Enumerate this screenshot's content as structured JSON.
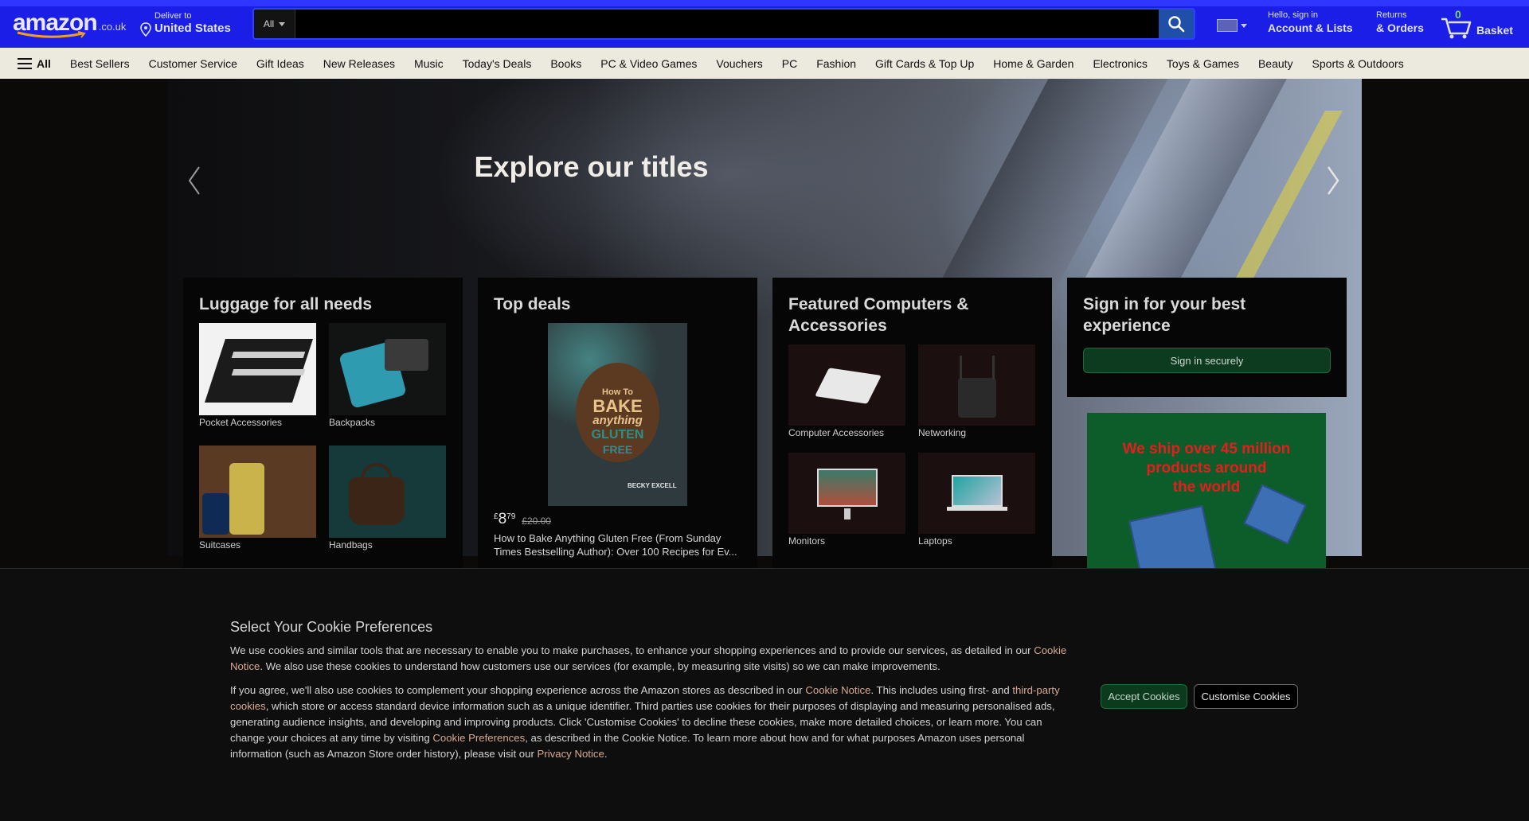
{
  "header": {
    "logo_text": "amazon",
    "logo_tld": ".co.uk",
    "deliver_line1": "Deliver to",
    "deliver_line2": "United States",
    "search": {
      "category": "All",
      "placeholder": "",
      "value": ""
    },
    "account_line1": "Hello, sign in",
    "account_line2": "Account & Lists",
    "orders_line1": "Returns",
    "orders_line2": "& Orders",
    "basket_count": "0",
    "basket_label": "Basket",
    "accent": "#1a1ee6"
  },
  "nav": {
    "all_label": "All",
    "items": [
      "Best Sellers",
      "Customer Service",
      "Gift Ideas",
      "New Releases",
      "Music",
      "Today's Deals",
      "Books",
      "PC & Video Games",
      "Vouchers",
      "PC",
      "Fashion",
      "Gift Cards & Top Up",
      "Home & Garden",
      "Electronics",
      "Toys & Games",
      "Beauty",
      "Sports & Outdoors"
    ]
  },
  "hero": {
    "title": "Explore our titles"
  },
  "cards": {
    "luggage": {
      "title": "Luggage for all needs",
      "tiles": [
        "Pocket Accessories",
        "Backpacks",
        "Suitcases",
        "Handbags"
      ]
    },
    "deals": {
      "title": "Top deals",
      "book_cover": {
        "line1": "How To",
        "line2": "BAKE",
        "line3": "anything",
        "line4": "GLUTEN",
        "line5": "FREE",
        "author": "BECKY EXCELL"
      },
      "price_symbol": "£",
      "price_whole": "8",
      "price_fraction": "79",
      "price_old": "£20.00",
      "description": "How to Bake Anything Gluten Free (From Sunday Times Bestselling Author): Over 100 Recipes for Ev..."
    },
    "computers": {
      "title": "Featured Computers & Accessories",
      "tiles": [
        "Computer Accessories",
        "Networking",
        "Monitors",
        "Laptops"
      ]
    },
    "signin": {
      "title": "Sign in for your best experience",
      "button": "Sign in securely"
    },
    "ship_ad": {
      "line1": "We ship over 45 million",
      "line2": "products around",
      "line3": "the world"
    }
  },
  "cookie": {
    "title": "Select Your Cookie Preferences",
    "p1_a": "We use cookies and similar tools that are necessary to enable you to make purchases, to enhance your shopping experiences and to provide our services, as detailed in our ",
    "p1_link": "Cookie Notice",
    "p1_b": ". We also use these cookies to understand how customers use our services (for example, by measuring site visits) so we can make improvements.",
    "p2_a": "If you agree, we'll also use cookies to complement your shopping experience across the Amazon stores as described in our ",
    "p2_link1": "Cookie Notice",
    "p2_b": ". This includes using first- and ",
    "p2_link2": "third-party cookies",
    "p2_c": ", which store or access standard device information such as a unique identifier. Third parties use cookies for their purposes of displaying and measuring personalised ads, generating audience insights, and developing and improving products. Click 'Customise Cookies' to decline these cookies, make more detailed choices, or learn more. You can change your choices at any time by visiting ",
    "p2_link3": "Cookie Preferences",
    "p2_d": ", as described in the Cookie Notice. To learn more about how and for what purposes Amazon uses personal information (such as Amazon Store order history), please visit our ",
    "p2_link4": "Privacy Notice",
    "p2_e": ".",
    "accept": "Accept Cookies",
    "customise": "Customise Cookies"
  }
}
